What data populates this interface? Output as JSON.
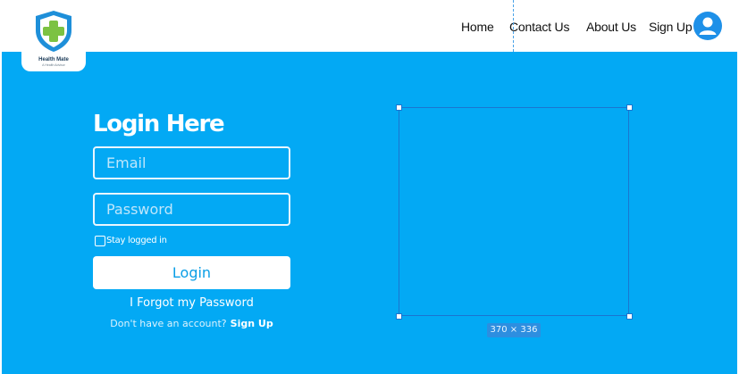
{
  "brand": {
    "name": "Health Mate",
    "tagline": "A Health Advisor",
    "logo_icon": "medical-cross-shield-icon",
    "colors": {
      "shield_blue": "#1e8fd9",
      "cross_green": "#7cc242",
      "brand_text": "#1b3a57"
    }
  },
  "nav": {
    "links": [
      "Home",
      "Contact Us",
      "About Us",
      "Sign Up"
    ],
    "avatar_icon": "user-avatar-icon"
  },
  "login": {
    "title": "Login Here",
    "email_placeholder": "Email",
    "password_placeholder": "Password",
    "stay_logged_in_label": "Stay logged in",
    "stay_logged_in_checked": false,
    "submit_label": "Login",
    "forgot_password": "I Forgot my Password",
    "signup_prompt": "Don't have an account?",
    "signup_link": "Sign Up"
  },
  "selection_overlay": {
    "size_label": "370 × 336"
  },
  "theme": {
    "hero_background": "#03a9f4",
    "accent_blue": "#1e90e8",
    "button_text": "#0a9ee6"
  }
}
